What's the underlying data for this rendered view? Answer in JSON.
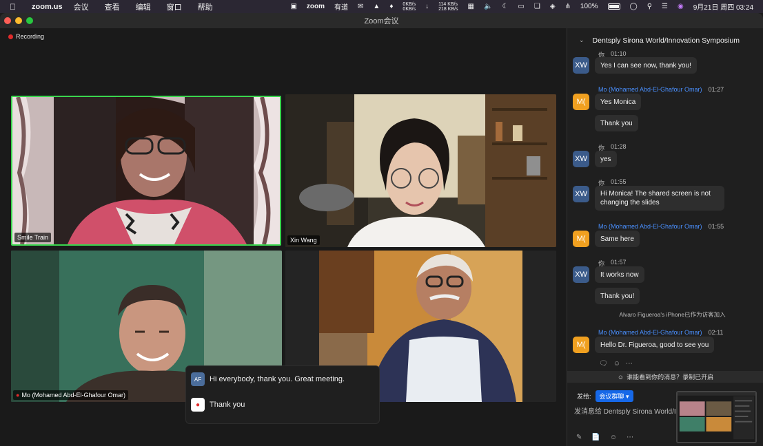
{
  "menubar": {
    "apple": "",
    "app_name": "zoom.us",
    "menus": [
      "会议",
      "查看",
      "编辑",
      "窗口",
      "帮助"
    ],
    "zoom_label": "zoom",
    "youdao": "有道",
    "net_up": "0KB/s",
    "net_down": "0KB/s",
    "net2_up": "114 KB/s",
    "net2_down": "218 KB/s",
    "battery": "100%",
    "datetime": "9月21日 周四  03:24"
  },
  "window": {
    "title": "Zoom会议",
    "recording_label": "Recording"
  },
  "participants": [
    {
      "name": "Smile Train"
    },
    {
      "name": "Xin Wang"
    },
    {
      "name": "Mo (Mohamed Abd-El-Ghafour Omar)"
    },
    {
      "name": ""
    }
  ],
  "reactions_popup": {
    "rows": [
      {
        "avatar": "AF",
        "text": "Hi everybody, thank you. Great meeting."
      },
      {
        "avatar": "",
        "text": "Thank you"
      }
    ]
  },
  "chat": {
    "header": "Dentsply Sirona World/Innovation Symposium",
    "messages": [
      {
        "avatar": "XW",
        "sender": "你",
        "time": "01:10",
        "bubbles": [
          "Yes I can see now, thank you!"
        ]
      },
      {
        "avatar": "M(",
        "sender": "Mo (Mohamed Abd-El-Ghafour Omar)",
        "time": "01:27",
        "bubbles": [
          "Yes Monica",
          "Thank you"
        ]
      },
      {
        "avatar": "XW",
        "sender": "你",
        "time": "01:28",
        "bubbles": [
          "yes"
        ]
      },
      {
        "avatar": "XW",
        "sender": "你",
        "time": "01:55",
        "bubbles": [
          "Hi Monica! The shared screen is not changing the slides"
        ]
      },
      {
        "avatar": "M(",
        "sender": "Mo (Mohamed Abd-El-Ghafour Omar)",
        "time": "01:55",
        "bubbles": [
          "Same here"
        ]
      },
      {
        "avatar": "XW",
        "sender": "你",
        "time": "01:57",
        "bubbles": [
          "It works now",
          "Thank you!"
        ]
      },
      {
        "avatar": "M(",
        "sender": "Mo (Mohamed Abd-El-Ghafour Omar)",
        "time": "02:11",
        "bubbles": [
          "Hello Dr. Figueroa, good to see you"
        ]
      }
    ],
    "system_message": "Alvaro Figueroa's iPhone已作为访客加入",
    "notice": "谁能看到你的消息？录制已开启",
    "send_to_label": "发给:",
    "send_to_target": "会议群聊",
    "input_placeholder": "发消息给 Dentsply Sirona World/I"
  },
  "colors": {
    "active_speaker": "#3ad64e",
    "accent": "#1668e8",
    "recording": "#e02b2b",
    "avatar_xw": "#3b5b8a",
    "avatar_mo": "#f0a020"
  }
}
